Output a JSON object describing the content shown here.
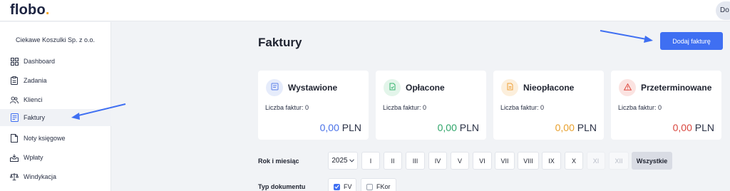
{
  "app": {
    "logo_text": "flobo",
    "logo_dot": ".",
    "user_initials": "Do"
  },
  "sidebar": {
    "company": "Ciekawe Koszulki Sp. z o.o.",
    "items": [
      {
        "label": "Dashboard",
        "icon": "dashboard-icon"
      },
      {
        "label": "Zadania",
        "icon": "clipboard-icon"
      },
      {
        "label": "Klienci",
        "icon": "users-icon"
      },
      {
        "label": "Faktury",
        "icon": "invoice-icon",
        "active": true
      },
      {
        "label": "Noty księgowe",
        "icon": "document-icon"
      },
      {
        "label": "Wpłaty",
        "icon": "inbox-icon"
      },
      {
        "label": "Windykacja",
        "icon": "scale-icon"
      }
    ]
  },
  "main": {
    "title": "Faktury",
    "add_button": "Dodaj fakturę",
    "cards": [
      {
        "title": "Wystawione",
        "count_label": "Liczba faktur: 0",
        "amount": "0,00",
        "currency": "PLN",
        "amount_color": "#4a72e8",
        "icon_bg": "#e6ecfb",
        "icon_color": "#5b7fe8",
        "icon": "invoice-icon"
      },
      {
        "title": "Opłacone",
        "count_label": "Liczba faktur: 0",
        "amount": "0,00",
        "currency": "PLN",
        "amount_color": "#2fa56a",
        "icon_bg": "#e3f5ea",
        "icon_color": "#34b36d",
        "icon": "document-check-icon"
      },
      {
        "title": "Nieopłacone",
        "count_label": "Liczba faktur: 0",
        "amount": "0,00",
        "currency": "PLN",
        "amount_color": "#e8a02c",
        "icon_bg": "#fcefdc",
        "icon_color": "#eea13a",
        "icon": "document-icon"
      },
      {
        "title": "Przeterminowane",
        "count_label": "Liczba faktur: 0",
        "amount": "0,00",
        "currency": "PLN",
        "amount_color": "#d9473f",
        "icon_bg": "#fbe3e1",
        "icon_color": "#de4a40",
        "icon": "warning-icon"
      }
    ],
    "filters": {
      "period_label": "Rok i miesiąc",
      "year": "2025",
      "months": [
        "I",
        "II",
        "III",
        "IV",
        "V",
        "VI",
        "VII",
        "VIII",
        "IX",
        "X",
        "XI",
        "XII"
      ],
      "disabled_months": [
        "XI",
        "XII"
      ],
      "all_label": "Wszystkie",
      "type_label": "Typ dokumentu",
      "types": [
        {
          "label": "FV",
          "checked": true
        },
        {
          "label": "FKor",
          "checked": false
        }
      ]
    }
  },
  "colors": {
    "accent": "#3f6ff2",
    "arrow": "#3f6ff2"
  }
}
